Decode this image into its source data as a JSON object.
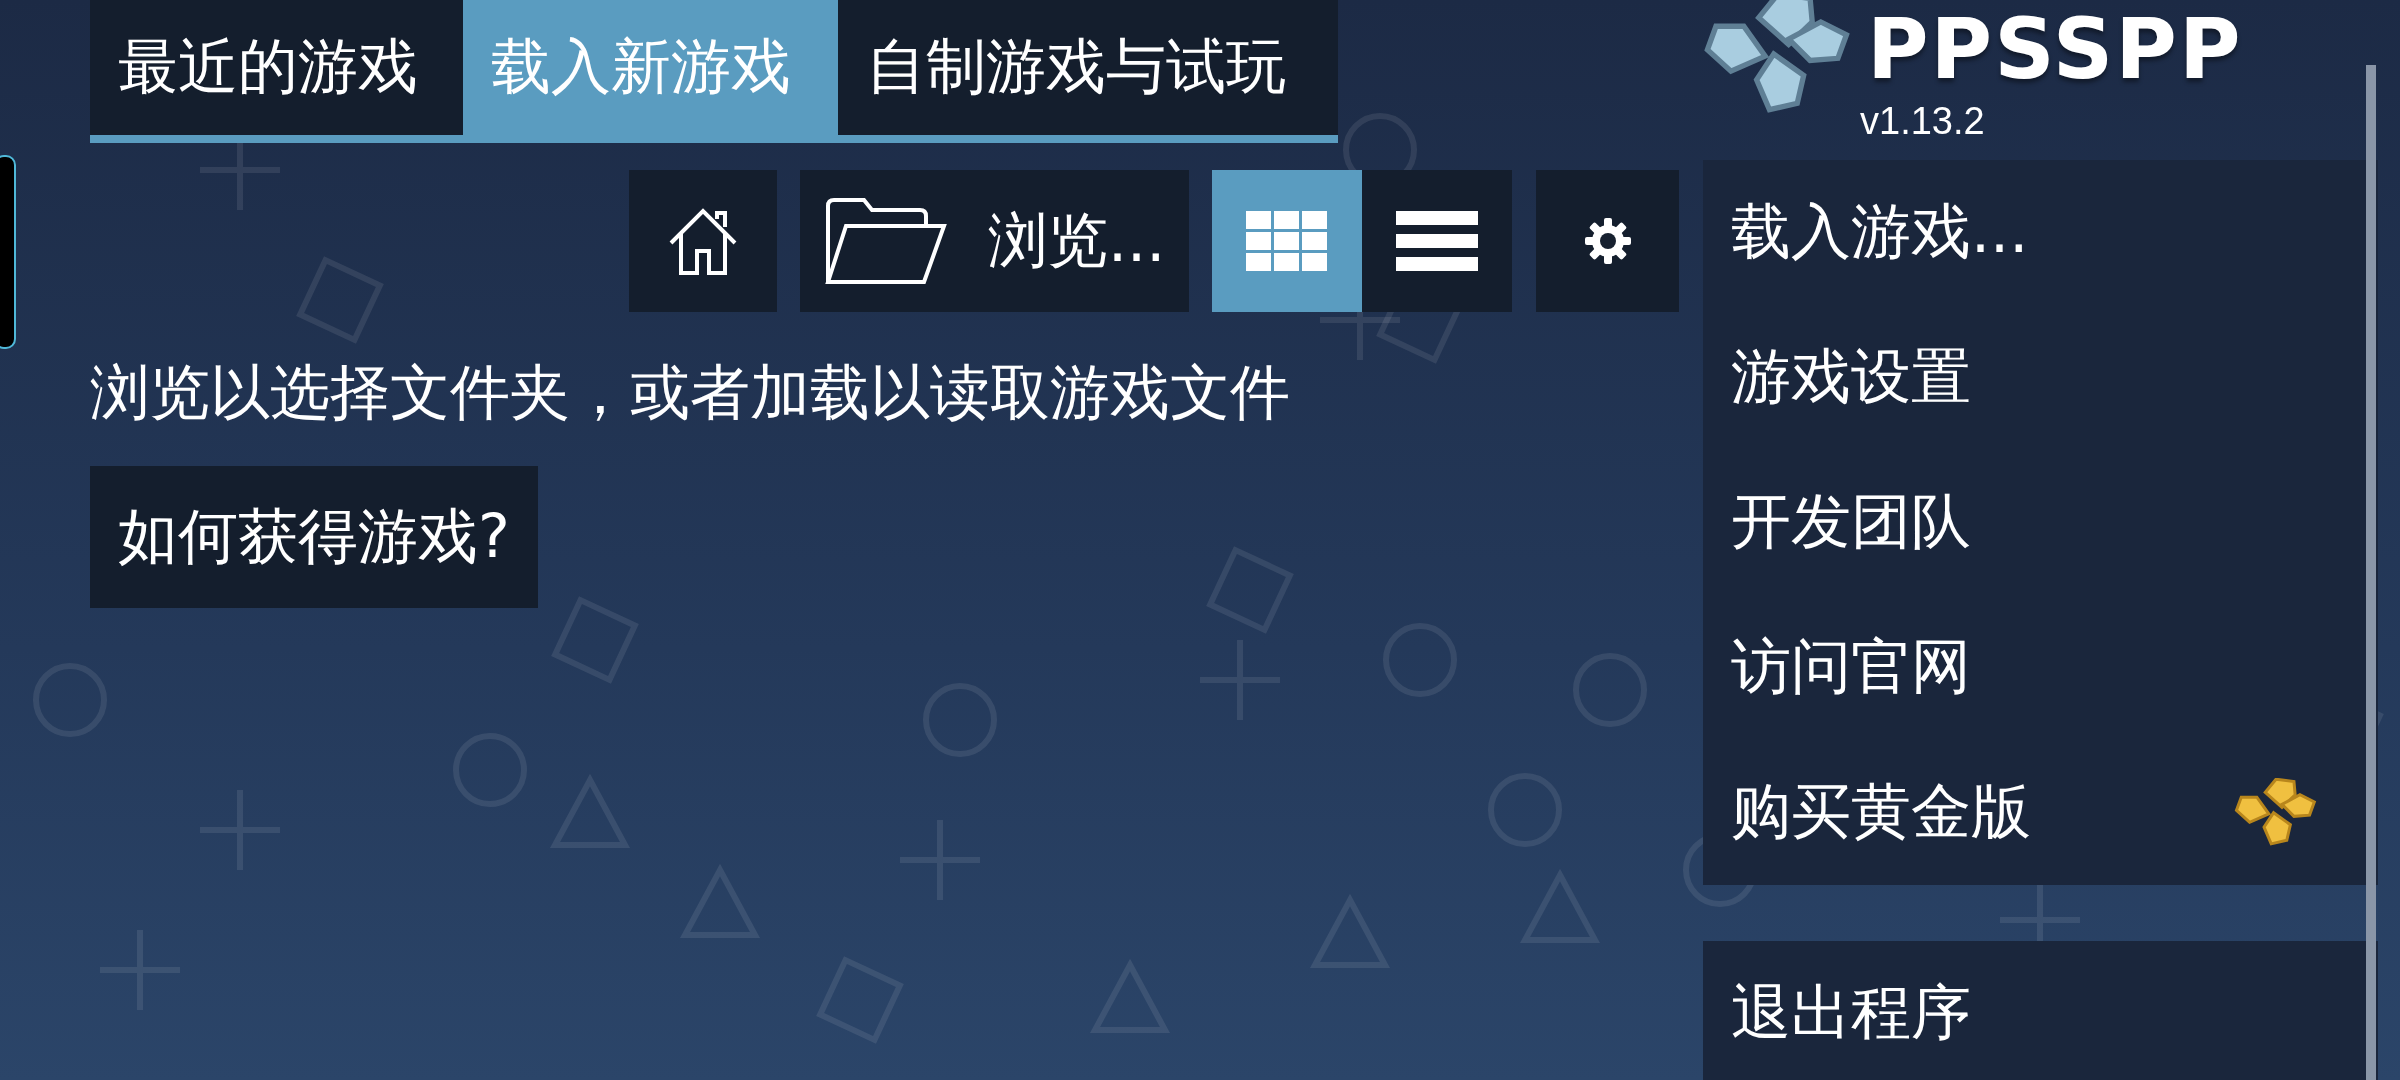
{
  "tabs": [
    {
      "label": "最近的游戏",
      "selected": false
    },
    {
      "label": "载入新游戏",
      "selected": true
    },
    {
      "label": "自制游戏与试玩",
      "selected": false
    }
  ],
  "toolbar": {
    "browse_label": "浏览...",
    "view_modes": [
      {
        "kind": "grid",
        "selected": true
      },
      {
        "kind": "list",
        "selected": false
      }
    ]
  },
  "hint": "浏览以选择文件夹，或者加载以读取游戏文件",
  "help_button": "如何获得游戏?",
  "logo": {
    "text": "PPSSPP",
    "version": "v1.13.2"
  },
  "menu": [
    {
      "label": "载入游戏...",
      "kind": "plain"
    },
    {
      "label": "游戏设置",
      "kind": "plain"
    },
    {
      "label": "开发团队",
      "kind": "plain"
    },
    {
      "label": "访问官网",
      "kind": "plain"
    },
    {
      "label": "购买黄金版",
      "kind": "gold"
    }
  ],
  "exit_button": "退出程序"
}
